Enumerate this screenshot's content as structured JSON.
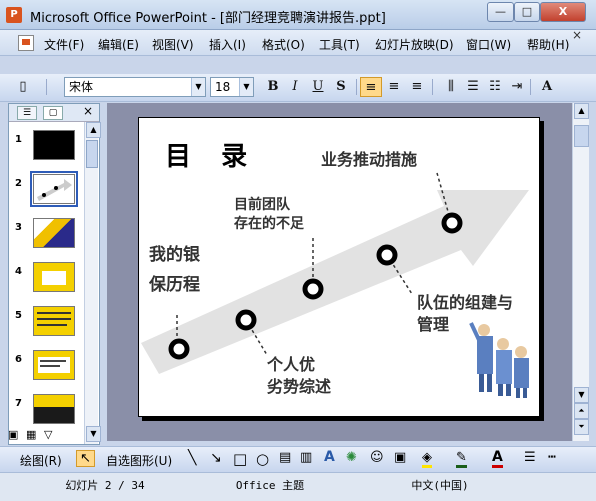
{
  "window": {
    "title": "Microsoft Office PowerPoint - [部门经理竞聘演讲报告.ppt]",
    "min_glyph": "—",
    "max_glyph": "□",
    "close_glyph": "X"
  },
  "menu": [
    "文件(F)",
    "编辑(E)",
    "视图(V)",
    "插入(I)",
    "格式(O)",
    "工具(T)",
    "幻灯片放映(D)",
    "窗口(W)",
    "帮助(H)"
  ],
  "menu_close_glyph": "×",
  "toolbar": {
    "font_name": "宋体",
    "font_size": "18",
    "bold": "B",
    "italic": "I",
    "underline": "U",
    "shadow": "S",
    "grow_font": "A"
  },
  "panel": {
    "close_glyph": "×",
    "slides": [
      {
        "num": "1"
      },
      {
        "num": "2"
      },
      {
        "num": "3"
      },
      {
        "num": "4"
      },
      {
        "num": "5"
      },
      {
        "num": "6"
      },
      {
        "num": "7"
      }
    ]
  },
  "slide": {
    "title": "目  录",
    "items": [
      "我的银",
      "保历程",
      "目前团队",
      "存在的不足",
      "业务推动措施",
      "个人优",
      "劣势综述",
      "队伍的组建与",
      "管理"
    ]
  },
  "drawbar": {
    "draw_label": "绘图(R)",
    "autoshape_label": "自选图形(U)"
  },
  "status": {
    "slide_counter": "幻灯片 2 / 34",
    "theme": "Office 主题",
    "language": "中文(中国)"
  },
  "colors": {
    "title_bar": "#c3d5ee",
    "slide_bg": "#ffffff",
    "arrow": "#e2e2e2",
    "accent": "#d39a2a"
  }
}
